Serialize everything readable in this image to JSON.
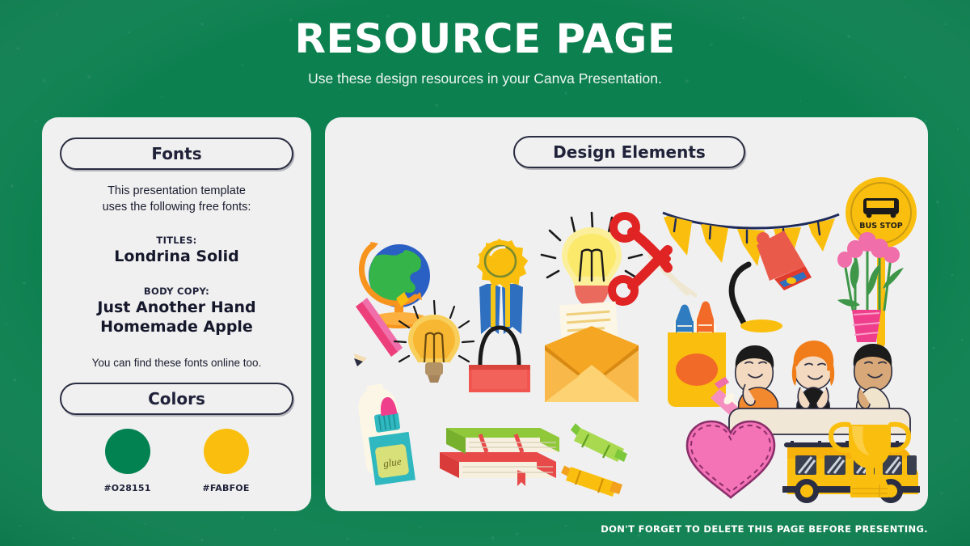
{
  "slide": {
    "title": "RESOURCE PAGE",
    "subtitle": "Use these design resources in your Canva Presentation.",
    "background_color": "#0D8050",
    "card_color": "#F0F0F0",
    "ink_color": "#2B2D42",
    "footer": "DON'T FORGET TO DELETE THIS PAGE BEFORE PRESENTING."
  },
  "fonts_card": {
    "heading": "Fonts",
    "intro": "This presentation template\nuses the following free fonts:",
    "intro_line1": "This presentation template",
    "intro_line2": "uses the following free fonts:",
    "titles_label": "TITLES:",
    "titles_font": "Londrina Solid",
    "body_label": "BODY COPY:",
    "body_font_line1": "Just Another Hand",
    "body_font_line2": "Homemade Apple",
    "outro": "You can find these fonts online too."
  },
  "colors_card": {
    "heading": "Colors",
    "swatches": [
      {
        "hex_label": "#O28151",
        "color": "#028151"
      },
      {
        "hex_label": "#FABFOE",
        "color": "#FABF0E"
      }
    ]
  },
  "design_card": {
    "heading": "Design Elements",
    "elements": [
      {
        "name": "globe-illustration",
        "label": "Globe on stand"
      },
      {
        "name": "award-ribbon-illustration",
        "label": "Gold award rosette with ribbons"
      },
      {
        "name": "lightbulb-yellow-illustration",
        "label": "Yellow lightbulb with rays"
      },
      {
        "name": "bunting-flags-illustration",
        "label": "Yellow bunting flags"
      },
      {
        "name": "bus-stop-sign-illustration",
        "label": "Bus stop sign"
      },
      {
        "name": "scissors-illustration",
        "label": "Red scissors"
      },
      {
        "name": "desk-lamp-illustration",
        "label": "Red desk lamp"
      },
      {
        "name": "tulip-bouquet-illustration",
        "label": "Pink tulip bouquet"
      },
      {
        "name": "pencil-illustration",
        "label": "Pink pencil"
      },
      {
        "name": "lightbulb-orange-illustration",
        "label": "Orange lightbulb"
      },
      {
        "name": "binder-clip-illustration",
        "label": "Red binder clip"
      },
      {
        "name": "envelope-illustration",
        "label": "Open envelope with letter"
      },
      {
        "name": "crayon-box-illustration",
        "label": "Crayon box with crayons"
      },
      {
        "name": "students-illustration",
        "label": "Three students at desk"
      },
      {
        "name": "glue-bottle-illustration",
        "label": "Glue bottle"
      },
      {
        "name": "books-stack-illustration",
        "label": "Stack of books"
      },
      {
        "name": "crayons-pair-illustration",
        "label": "Green and orange crayons"
      },
      {
        "name": "heart-illustration",
        "label": "Pink stitched heart"
      },
      {
        "name": "school-bus-illustration",
        "label": "Yellow school bus"
      },
      {
        "name": "trophy-illustration",
        "label": "Gold trophy"
      }
    ],
    "bus_stop_text": "BUS STOP",
    "glue_label": "glue"
  }
}
